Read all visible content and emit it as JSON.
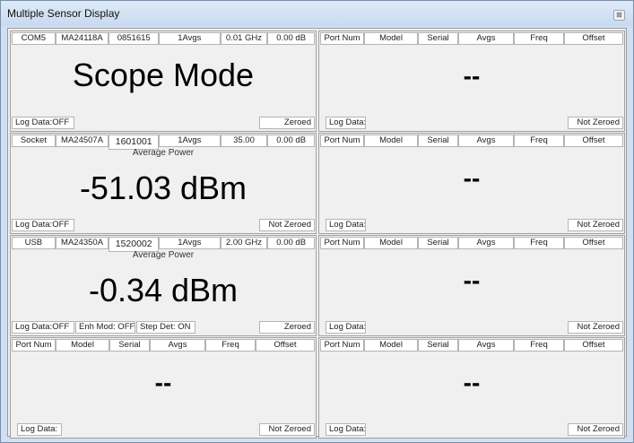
{
  "window": {
    "title": "Multiple Sensor Display",
    "close_label": "⊠"
  },
  "empty_header": [
    "Port Num",
    "Model",
    "Serial",
    "Avgs",
    "Freq",
    "Offset"
  ],
  "panels": {
    "p1": {
      "header": [
        "COM5",
        "MA24118A",
        "0851615",
        "1Avgs",
        "0.01 GHz",
        "0.00 dB"
      ],
      "main": "Scope Mode",
      "log": "Log Data:OFF",
      "zero": "Zeroed"
    },
    "p2": {
      "main": "--",
      "log": "Log Data:",
      "zero": "Not Zeroed"
    },
    "p3": {
      "header": [
        "Socket",
        "MA24507A",
        "1601001",
        "1Avgs",
        "35.00",
        "0.00 dB"
      ],
      "label": "Average Power",
      "main": "-51.03 dBm",
      "log": "Log Data:OFF",
      "zero": "Not Zeroed"
    },
    "p4": {
      "main": "--",
      "log": "Log Data:",
      "zero": "Not Zeroed"
    },
    "p5": {
      "header": [
        "USB",
        "MA24350A",
        "1520002",
        "1Avgs",
        "2.00 GHz",
        "0.00 dB"
      ],
      "label": "Average Power",
      "main": "-0.34 dBm",
      "log": "Log Data:OFF",
      "enh": "Enh Mod: OFF",
      "step": "Step Det: ON",
      "zero": "Zeroed"
    },
    "p6": {
      "main": "--",
      "log": "Log Data:",
      "zero": "Not Zeroed"
    },
    "p7": {
      "main": "--",
      "log": "Log Data:",
      "zero": "Not Zeroed"
    },
    "p8": {
      "main": "--",
      "log": "Log Data:",
      "zero": "Not Zeroed"
    }
  }
}
